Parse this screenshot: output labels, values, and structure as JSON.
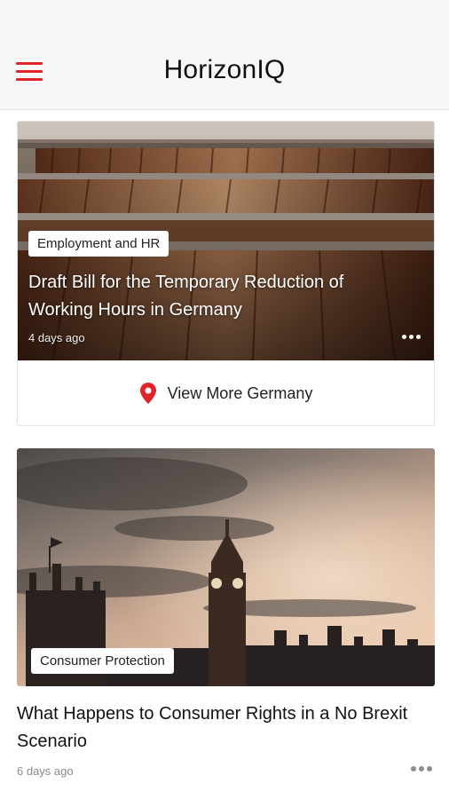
{
  "header": {
    "title": "HorizonIQ",
    "menu_icon": "hamburger-menu-icon",
    "accent_color": "#e0242b"
  },
  "featured": {
    "category": "Employment and HR",
    "title": "Draft Bill for the Temporary Reduction of Working Hours in Germany",
    "date": "4 days ago",
    "more_icon": "more-horizontal-icon",
    "image": "law-books-on-shelves-photo",
    "view_more": {
      "icon": "location-pin-icon",
      "label": "View More Germany"
    }
  },
  "article": {
    "category": "Consumer Protection",
    "title": "What Happens to Consumer Rights in a No Brexit Scenario",
    "date": "6 days ago",
    "more_icon": "more-horizontal-icon",
    "image": "big-ben-sunset-photo"
  }
}
